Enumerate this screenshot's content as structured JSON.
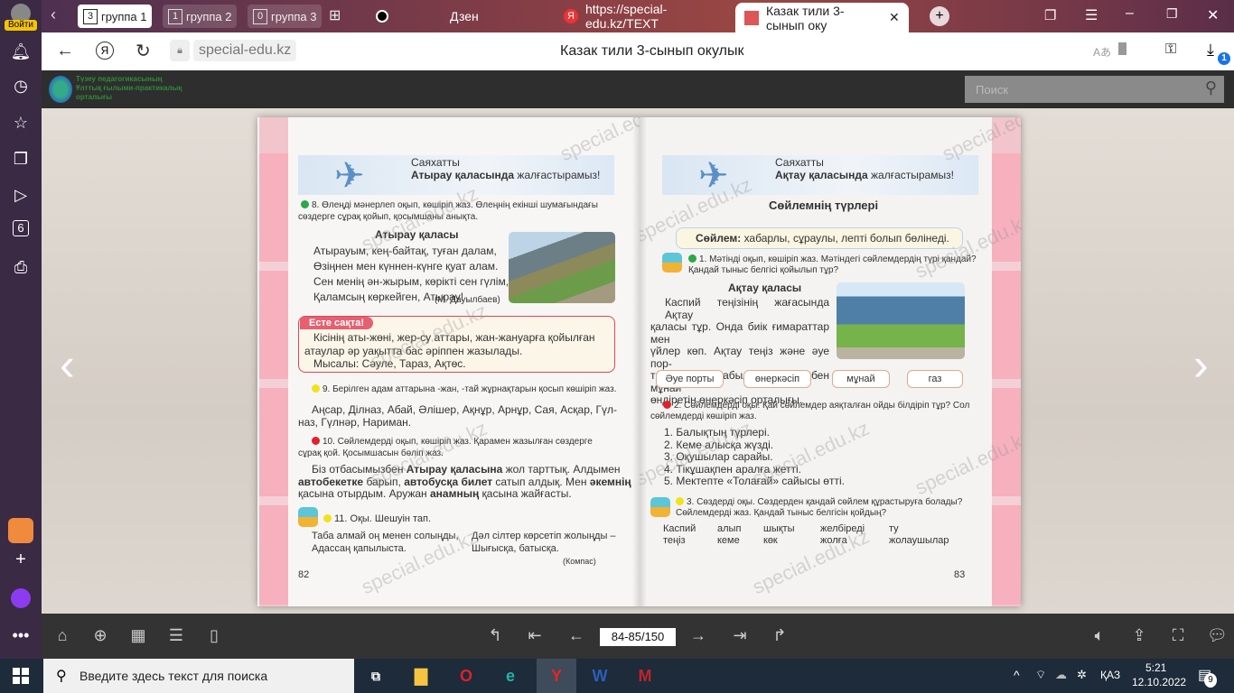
{
  "sidebar": {
    "login_label": "Войти",
    "icons": [
      "bell-icon",
      "history-icon",
      "star-icon",
      "collections-icon",
      "video-icon",
      "6",
      "screenshot-icon"
    ],
    "six": "6"
  },
  "tabbar": {
    "groups": [
      {
        "count": "3",
        "label": "группа 1"
      },
      {
        "count": "1",
        "label": "группа 2"
      },
      {
        "count": "0",
        "label": "группа 3"
      }
    ],
    "tabs": [
      {
        "label": "Дзен"
      },
      {
        "label": "https://special-edu.kz/TEXT"
      },
      {
        "label": "Казак тили 3-сынып оку"
      }
    ]
  },
  "address": {
    "domain": "special-edu.kz",
    "page_title": "Казак тили 3-сынып окулык",
    "downloads_badge": "1"
  },
  "site": {
    "logo_lines": [
      "Түзеу педагогикасының",
      "Ұлттық ғылыми-практикалық",
      "орталығы"
    ],
    "search_placeholder": "Поиск"
  },
  "left_page": {
    "header_small": "Саяхатты",
    "header_bold": "Атырау қаласында",
    "header_rest": " жалғастырамыз!",
    "task8": "8. Өлеңді мәнерлеп оқып, көшіріп жаз. Өлеңнің екінші шумағындағы",
    "task8b": "сөздерге сұрақ қойып, қосымшаны анықта.",
    "poem_title": "Атырау қаласы",
    "poem": [
      "Атырауым, кең-байтақ, туған далам,",
      "Өзіңнен мен күннен-күнге қуат алам.",
      "Сен менің ән-жырым, көрікті сен гүлім,",
      "Қаламсың көркейген, Атырау!"
    ],
    "author": "(М. Дауылбаев)",
    "remember_label": "Есте сақта!",
    "remember_lines": [
      "Кісінің аты-жөні, жер-су аттары, жан-жануарға қойылған",
      "атаулар әр уақытта бас әріппен жазылады.",
      "Мысалы: Сәуле, Тараз, Ақтөс."
    ],
    "task9": "9. Берілген адам аттарына -жан, -тай жұрнақтарын қосып көшіріп жаз.",
    "names": [
      "Аңсар, Ділназ, Абай, Әлішер, Ақнұр, Арнұр, Сая, Асқар, Гүл-",
      "наз, Гүлнәр, Нариман."
    ],
    "task10": "10. Сөйлемдерді оқып, көшіріп жаз. Қарамен жазылған сөздерге",
    "task10b": "сұрақ қой. Қосымшасын бөліп жаз.",
    "para": {
      "l1a": "Біз отбасымызбен ",
      "l1b": "Атырау қаласына",
      "l1c": " жол тарттық. Алдымен",
      "l2a": "автобекетке",
      "l2b": " барып, ",
      "l2c": "автобусқа билет",
      "l2d": " сатып алдық. Мен ",
      "l2e": "әкемнің",
      "l3a": "қасына отырдым. Аружан ",
      "l3b": "анамның",
      "l3c": " қасына жайғасты."
    },
    "task11": "11. Оқы. Шешуін тап.",
    "riddle": [
      "Таба алмай оң менен солыңды,",
      "Адассаң қапылыста.",
      "Дәл сілтер көрсетіп жолыңды –",
      "Шығысқа, батысқа."
    ],
    "answer": "(Компас)",
    "page_no": "82"
  },
  "right_page": {
    "header_small": "Саяхатты",
    "header_bold": "Ақтау қаласында",
    "header_rest": " жалғастырамыз!",
    "topic": "Сөйлемнің түрлері",
    "rule_bold": "Сөйлем:",
    "rule_rest": " хабарлы, сұраулы, лепті болып бөлінеді.",
    "task1": "1. Мәтінді оқып, көшіріп жаз. Мәтіндегі сөйлемдердің түрі қандай?",
    "task1b": "Қандай тыныс белгісі қойылып тұр?",
    "text_title": "Ақтау қаласы",
    "text": [
      "Каспий теңізінің жағасында Ақтау",
      "қаласы тұр. Онда биік ғимараттар мен",
      "үйлер көп. Ақтау теңіз және әуе пор-",
      "ты болып табылады. Газ бен мұнай",
      "өндіретін өнеркәсіп орталығы."
    ],
    "chips": [
      "Әуе порты",
      "өнеркәсіп",
      "мұнай",
      "газ"
    ],
    "task2": "2. Сөйлемдерді оқы. Қай сөйлемдер аяқталған ойды білдіріп тұр? Сол",
    "task2b": "сөйлемдерді көшіріп жаз.",
    "list": [
      "1. Балықтың түрлері.",
      "2. Кеме алысқа жүзді.",
      "3. Оқушылар сарайы.",
      "4. Тікұшақпен аралға жетті.",
      "5. Мектепте «Толағай» сайысы өтті."
    ],
    "task3": "3. Сөздерді оқы. Сөздерден қандай сөйлем құрастыруға болады?",
    "task3b": "Сөйлемдерді жаз. Қандай тыныс белгісін қойдың?",
    "words": [
      [
        "Каспий",
        "теңіз"
      ],
      [
        "алып",
        "кеме"
      ],
      [
        "шықты",
        "көк"
      ],
      [
        "желбіреді",
        "жолға"
      ],
      [
        "ту",
        "жолаушылар"
      ]
    ],
    "page_no": "83"
  },
  "watermark": "special.edu.kz",
  "toolbar": {
    "page_indicator": "84-85/150"
  },
  "taskbar": {
    "search_placeholder": "Введите здесь текст для поиска",
    "lang": "ҚАЗ",
    "time": "5:21",
    "date": "12.10.2022",
    "notif_count": "9"
  },
  "colors": {
    "accent_pink": "#f5a9b8",
    "dot_green": "#2aa84a",
    "dot_red": "#e3202a",
    "dot_yellow": "#f2e21a",
    "remember_red": "#e0455a"
  }
}
